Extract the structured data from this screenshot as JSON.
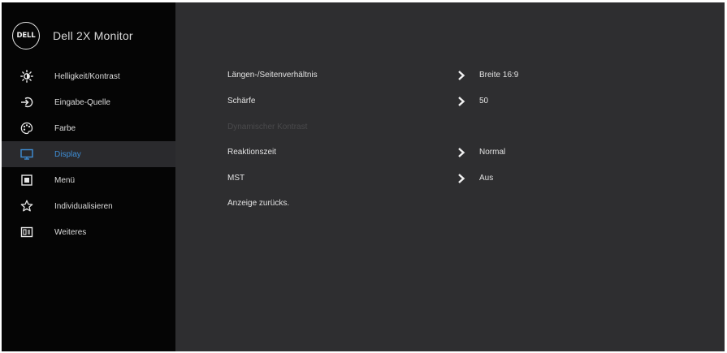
{
  "brand": {
    "logo_text": "DELL",
    "product": "Dell 2X Monitor"
  },
  "sidebar": {
    "items": [
      {
        "label": "Helligkeit/Kontrast",
        "icon": "brightness-icon",
        "active": false
      },
      {
        "label": "Eingabe-Quelle",
        "icon": "input-source-icon",
        "active": false
      },
      {
        "label": "Farbe",
        "icon": "color-palette-icon",
        "active": false
      },
      {
        "label": "Display",
        "icon": "display-icon",
        "active": true
      },
      {
        "label": "Menü",
        "icon": "menu-icon",
        "active": false
      },
      {
        "label": "Individualisieren",
        "icon": "star-icon",
        "active": false
      },
      {
        "label": "Weiteres",
        "icon": "others-icon",
        "active": false
      }
    ]
  },
  "main": {
    "settings": [
      {
        "label": "Längen-/Seitenverhältnis",
        "value": "Breite 16:9",
        "enabled": true,
        "has_arrow": true
      },
      {
        "label": "Schärfe",
        "value": "50",
        "enabled": true,
        "has_arrow": true
      },
      {
        "label": "Dynamischer Kontrast",
        "value": "",
        "enabled": false,
        "has_arrow": false
      },
      {
        "label": "Reaktionszeit",
        "value": "Normal",
        "enabled": true,
        "has_arrow": true
      },
      {
        "label": "MST",
        "value": "Aus",
        "enabled": true,
        "has_arrow": true
      },
      {
        "label": "Anzeige zurücks.",
        "value": "",
        "enabled": true,
        "has_arrow": false
      }
    ]
  },
  "colors": {
    "sidebar_bg": "#050505",
    "main_bg": "#2e2e30",
    "active_item_bg": "#2a2a2d",
    "active_text": "#3e8ed6",
    "text": "#e2e2e2"
  }
}
